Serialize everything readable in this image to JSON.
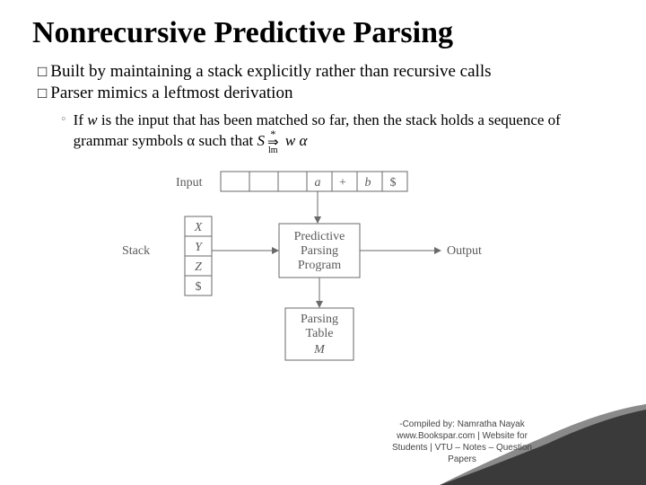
{
  "title": "Nonrecursive Predictive Parsing",
  "bullets": {
    "b1": "Built by maintaining a stack explicitly rather than recursive calls",
    "b2": "Parser mimics a leftmost derivation",
    "sub1_prefix": "If ",
    "sub1_w": "w",
    "sub1_mid": " is the input that has been matched so far, then the stack holds a sequence of grammar symbols α such that   ",
    "sub1_S": "S",
    "sub1_star": "*",
    "sub1_arrow": "⇒",
    "sub1_lm": "lm",
    "sub1_rhs": "  w α"
  },
  "diagram": {
    "input_label": "Input",
    "stack_label": "Stack",
    "output_label": "Output",
    "program_l1": "Predictive",
    "program_l2": "Parsing",
    "program_l3": "Program",
    "table_l1": "Parsing",
    "table_l2": "Table",
    "table_l3": "M",
    "input_cells": [
      "a",
      "+",
      "b",
      "$"
    ],
    "stack_cells": [
      "X",
      "Y",
      "Z",
      "$"
    ]
  },
  "footer": {
    "l1": "-Compiled by: Namratha Nayak",
    "l2": "www.Bookspar.com | Website for",
    "l3": "Students | VTU – Notes – Question",
    "l4": "Papers"
  }
}
